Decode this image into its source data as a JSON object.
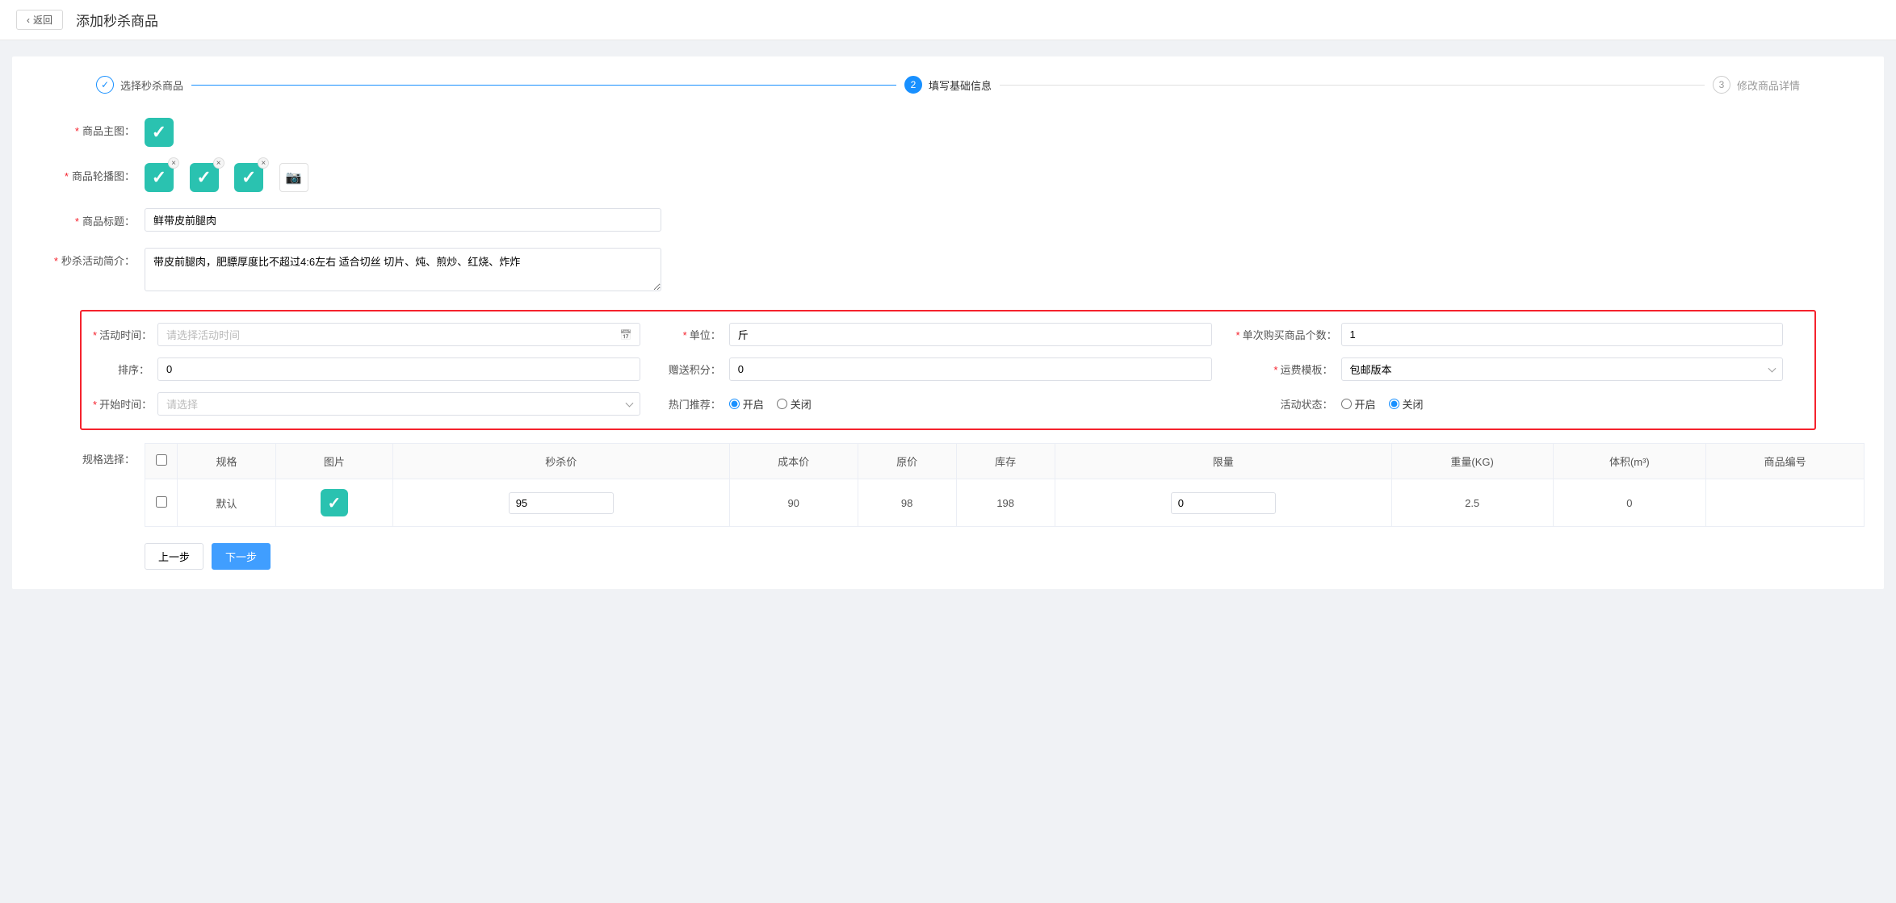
{
  "header": {
    "back_label": "返回",
    "title": "添加秒杀商品"
  },
  "steps": {
    "s1": "选择秒杀商品",
    "s2": "填写基础信息",
    "s3": "修改商品详情"
  },
  "form": {
    "main_image_label": "商品主图：",
    "carousel_label": "商品轮播图：",
    "title_label": "商品标题：",
    "title_value": "鲜带皮前腿肉",
    "intro_label": "秒杀活动简介：",
    "intro_value": "带皮前腿肉，肥膘厚度比不超过4:6左右 适合切丝 切片、炖、煎炒、红烧、炸炸"
  },
  "section": {
    "event_time_label": "活动时间：",
    "event_time_placeholder": "请选择活动时间",
    "unit_label": "单位：",
    "unit_value": "斤",
    "limit_label": "单次购买商品个数：",
    "limit_value": "1",
    "sort_label": "排序：",
    "sort_value": "0",
    "points_label": "赠送积分：",
    "points_value": "0",
    "ship_tpl_label": "运费模板：",
    "ship_tpl_value": "包邮版本",
    "start_time_label": "开始时间：",
    "start_time_placeholder": "请选择",
    "hot_label": "热门推荐：",
    "status_label": "活动状态：",
    "radio_on": "开启",
    "radio_off": "关闭"
  },
  "spec": {
    "section_label": "规格选择：",
    "headers": {
      "spec": "规格",
      "image": "图片",
      "flash_price": "秒杀价",
      "cost_price": "成本价",
      "orig_price": "原价",
      "stock": "库存",
      "limit": "限量",
      "weight": "重量(KG)",
      "volume": "体积(m³)",
      "sku": "商品编号"
    },
    "rows": [
      {
        "spec": "默认",
        "flash_price": "95",
        "cost_price": "90",
        "orig_price": "98",
        "stock": "198",
        "limit": "0",
        "weight": "2.5",
        "volume": "0",
        "sku": ""
      }
    ]
  },
  "footer": {
    "prev": "上一步",
    "next": "下一步"
  }
}
